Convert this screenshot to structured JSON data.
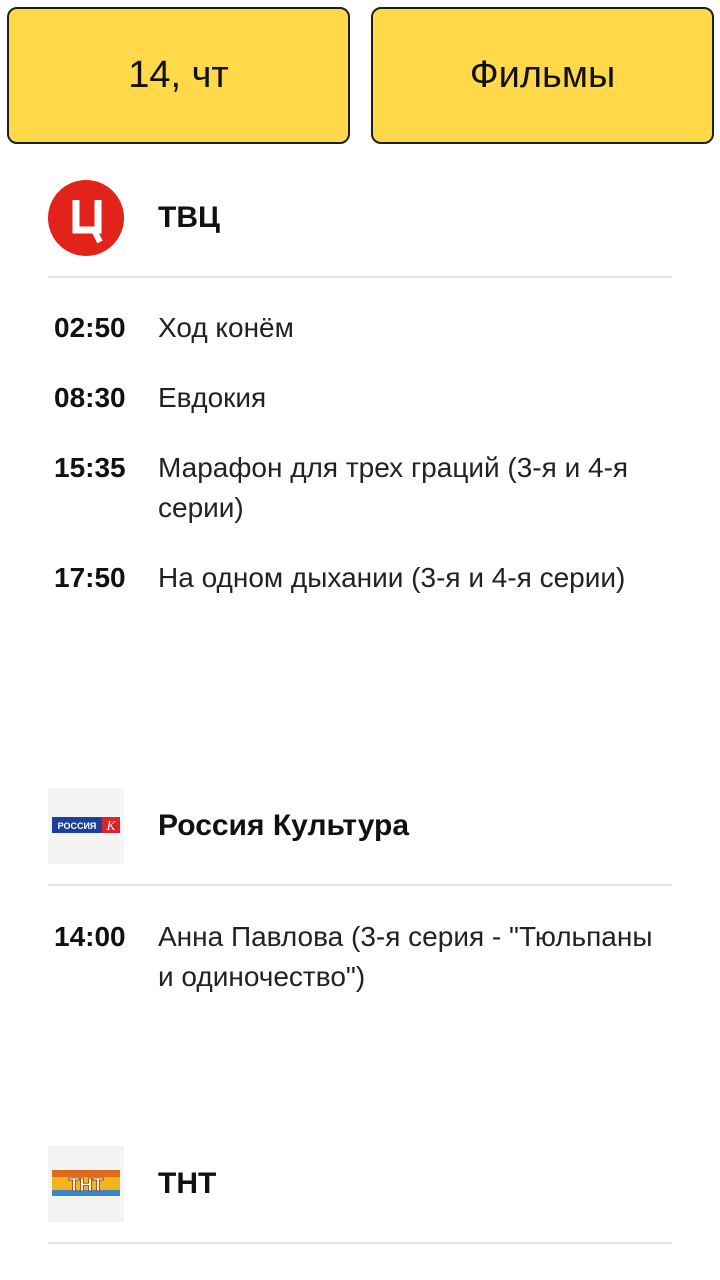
{
  "filters": {
    "date_label": "14, чт",
    "genre_label": "Фильмы"
  },
  "channels": [
    {
      "name": "ТВЦ",
      "logo_icon": "tvc-logo-icon",
      "programs": [
        {
          "time": "02:50",
          "title": "Ход конём"
        },
        {
          "time": "08:30",
          "title": "Евдокия"
        },
        {
          "time": "15:35",
          "title": "Марафон для трех граций (3-я и 4-я серии)"
        },
        {
          "time": "17:50",
          "title": "На одном дыхании (3-я и 4-я серии)"
        }
      ]
    },
    {
      "name": "Россия Культура",
      "logo_icon": "russia-kultura-logo-icon",
      "logo_text": "РОССИЯ",
      "logo_letter": "К",
      "programs": [
        {
          "time": "14:00",
          "title": "Анна Павлова (3-я серия - \"Тюльпаны и одиночество\")"
        }
      ]
    },
    {
      "name": "ТНТ",
      "logo_icon": "tnt-logo-icon",
      "logo_text": "ТНТ",
      "programs": []
    }
  ],
  "colors": {
    "filter_bg": "#FFD94A",
    "tvc_red": "#E2231A",
    "divider": "#E6E6E6"
  }
}
